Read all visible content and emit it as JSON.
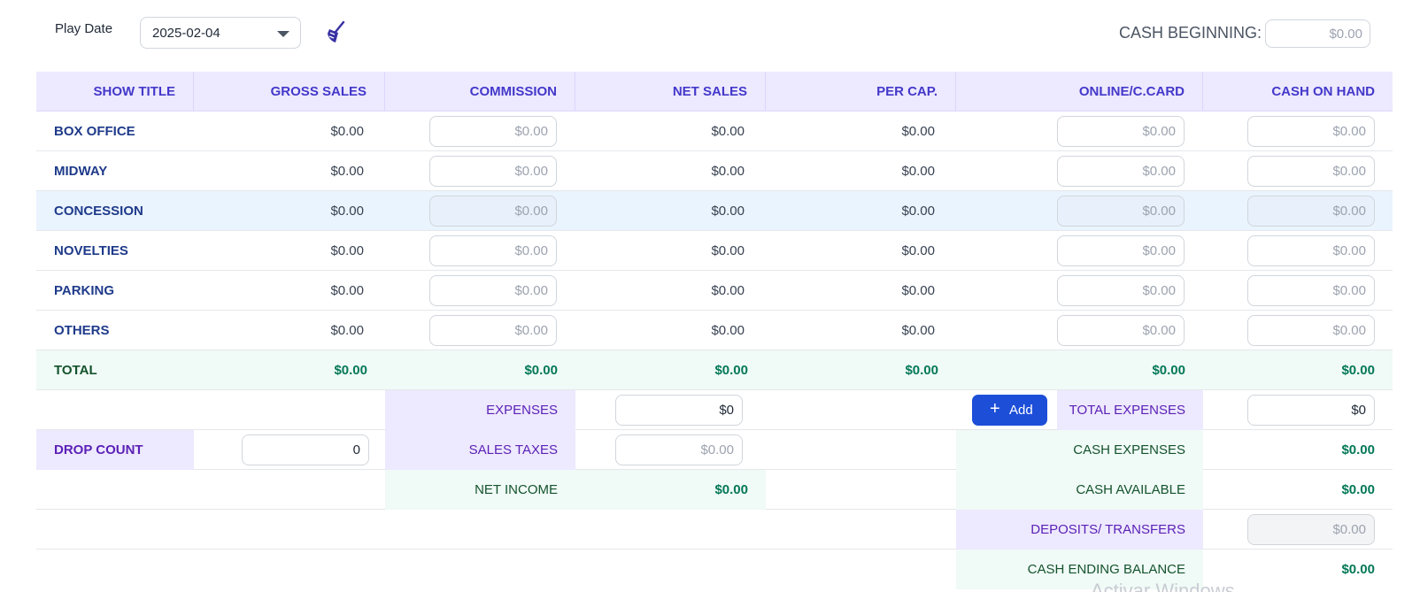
{
  "toolbar": {
    "play_date_label": "Play Date",
    "play_date_value": "2025-02-04",
    "clean_icon": "broom-icon",
    "cash_beginning_label": "CASH BEGINNING:",
    "cash_beginning_value": "$0.00"
  },
  "table": {
    "headers": [
      "SHOW TITLE",
      "GROSS SALES",
      "COMMISSION",
      "NET SALES",
      "PER CAP.",
      "ONLINE/C.CARD",
      "CASH ON HAND"
    ],
    "rows": [
      {
        "title": "BOX OFFICE",
        "gross": "$0.00",
        "commission": "$0.00",
        "net": "$0.00",
        "percap": "$0.00",
        "online": "$0.00",
        "cash": "$0.00"
      },
      {
        "title": "MIDWAY",
        "gross": "$0.00",
        "commission": "$0.00",
        "net": "$0.00",
        "percap": "$0.00",
        "online": "$0.00",
        "cash": "$0.00"
      },
      {
        "title": "CONCESSION",
        "gross": "$0.00",
        "commission": "$0.00",
        "net": "$0.00",
        "percap": "$0.00",
        "online": "$0.00",
        "cash": "$0.00"
      },
      {
        "title": "NOVELTIES",
        "gross": "$0.00",
        "commission": "$0.00",
        "net": "$0.00",
        "percap": "$0.00",
        "online": "$0.00",
        "cash": "$0.00"
      },
      {
        "title": "PARKING",
        "gross": "$0.00",
        "commission": "$0.00",
        "net": "$0.00",
        "percap": "$0.00",
        "online": "$0.00",
        "cash": "$0.00"
      },
      {
        "title": "OTHERS",
        "gross": "$0.00",
        "commission": "$0.00",
        "net": "$0.00",
        "percap": "$0.00",
        "online": "$0.00",
        "cash": "$0.00"
      }
    ],
    "total": {
      "label": "TOTAL",
      "gross": "$0.00",
      "commission": "$0.00",
      "net": "$0.00",
      "percap": "$0.00",
      "online": "$0.00",
      "cash": "$0.00"
    }
  },
  "summary": {
    "expenses_label": "EXPENSES",
    "expenses_value": "$0",
    "add_button": "Add",
    "total_expenses_label": "TOTAL EXPENSES",
    "total_expenses_value": "$0",
    "drop_count_label": "DROP COUNT",
    "drop_count_value": "0",
    "sales_taxes_label": "SALES TAXES",
    "sales_taxes_value": "$0.00",
    "cash_expenses_label": "CASH EXPENSES",
    "cash_expenses_value": "$0.00",
    "net_income_label": "NET INCOME",
    "net_income_value": "$0.00",
    "cash_available_label": "CASH AVAILABLE",
    "cash_available_value": "$0.00",
    "deposits_label": "DEPOSITS/ TRANSFERS",
    "deposits_value": "$0.00",
    "cash_ending_label": "CASH ENDING BALANCE",
    "cash_ending_value": "$0.00"
  },
  "watermark": "Activar Windows",
  "colors": {
    "header_bg": "#ede9fe",
    "header_text": "#4338ca",
    "row_label": "#1e3a8a",
    "total_text": "#047857",
    "highlight_row": "#eaf4fe",
    "accent_button": "#1d4ed8"
  }
}
